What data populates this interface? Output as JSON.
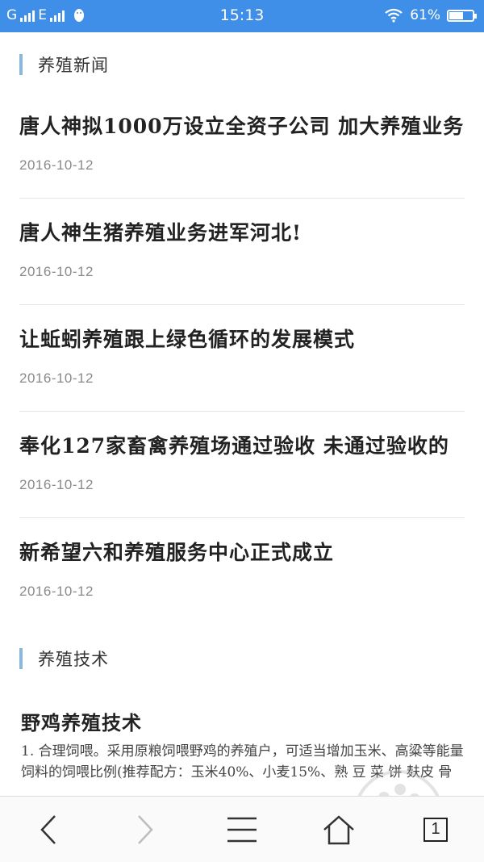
{
  "status_bar": {
    "network_left": "G",
    "network_right": "E",
    "time": "15:13",
    "battery": "61%",
    "battery_level": 0.61,
    "icons": [
      "signal-icon",
      "qq-penguin-icon",
      "wifi-icon",
      "battery-icon"
    ]
  },
  "sections": {
    "news": {
      "title": "养殖新闻",
      "items": [
        {
          "headline": "唐人神拟1000万设立全资子公司 加大养殖业务",
          "date": "2016-10-12"
        },
        {
          "headline": "唐人神生猪养殖业务进军河北!",
          "date": "2016-10-12"
        },
        {
          "headline": "让蚯蚓养殖跟上绿色循环的发展模式",
          "date": "2016-10-12"
        },
        {
          "headline": "奉化127家畜禽养殖场通过验收 未通过验收的",
          "date": "2016-10-12"
        },
        {
          "headline": "新希望六和养殖服务中心正式成立",
          "date": "2016-10-12"
        }
      ]
    },
    "tech": {
      "title": "养殖技术",
      "article_title": "野鸡养殖技术",
      "article_excerpt": "1. 合理饲喂。采用原粮饲喂野鸡的养殖户，可适当增加玉米、高粱等能量饲料的饲喂比例(推荐配方：玉米40%、小麦15%、熟 豆 菜 饼 麸皮 骨"
    }
  },
  "toolbar": {
    "back": "back-arrow-icon",
    "forward": "forward-arrow-icon",
    "menu": "menu-icon",
    "home": "home-icon",
    "tab_count": "1"
  },
  "colors": {
    "status_bar": "#3f8fe8",
    "section_bar": "#8db6dc",
    "date_text": "#8a8a8a"
  }
}
